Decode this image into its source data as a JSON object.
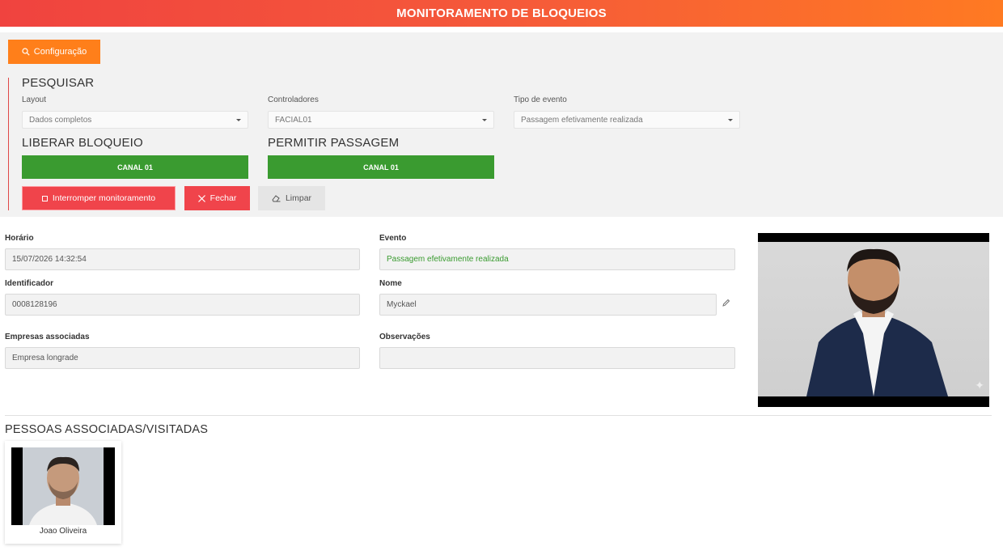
{
  "header": {
    "title": "MONITORAMENTO DE BLOQUEIOS"
  },
  "toolbar": {
    "config_label": "Configuração"
  },
  "search": {
    "title": "PESQUISAR",
    "layout": {
      "label": "Layout",
      "value": "Dados completos"
    },
    "controladores": {
      "label": "Controladores",
      "value": "FACIAL01"
    },
    "tipo_evento": {
      "label": "Tipo de evento",
      "value": "Passagem efetivamente realizada"
    }
  },
  "liberar": {
    "title": "LIBERAR BLOQUEIO",
    "button": "CANAL 01"
  },
  "permitir": {
    "title": "PERMITIR PASSAGEM",
    "button": "CANAL 01"
  },
  "actions": {
    "stop": "Interromper monitoramento",
    "close": "Fechar",
    "clear": "Limpar"
  },
  "details": {
    "horario": {
      "label": "Horário",
      "value": "15/07/2026 14:32:54"
    },
    "evento": {
      "label": "Evento",
      "value": "Passagem efetivamente realizada"
    },
    "identificador": {
      "label": "Identificador",
      "value": "0008128196"
    },
    "nome": {
      "label": "Nome",
      "value": "Myckael"
    },
    "empresas": {
      "label": "Empresas associadas",
      "value": "Empresa longrade"
    },
    "observacoes": {
      "label": "Observações",
      "value": ""
    }
  },
  "associated": {
    "title": "PESSOAS ASSOCIADAS/VISITADAS",
    "people": [
      {
        "name": "Joao Oliveira"
      }
    ]
  },
  "colors": {
    "accent_orange": "#ff7f1a",
    "success_green": "#3a9b30",
    "danger_red": "#f0444b"
  }
}
